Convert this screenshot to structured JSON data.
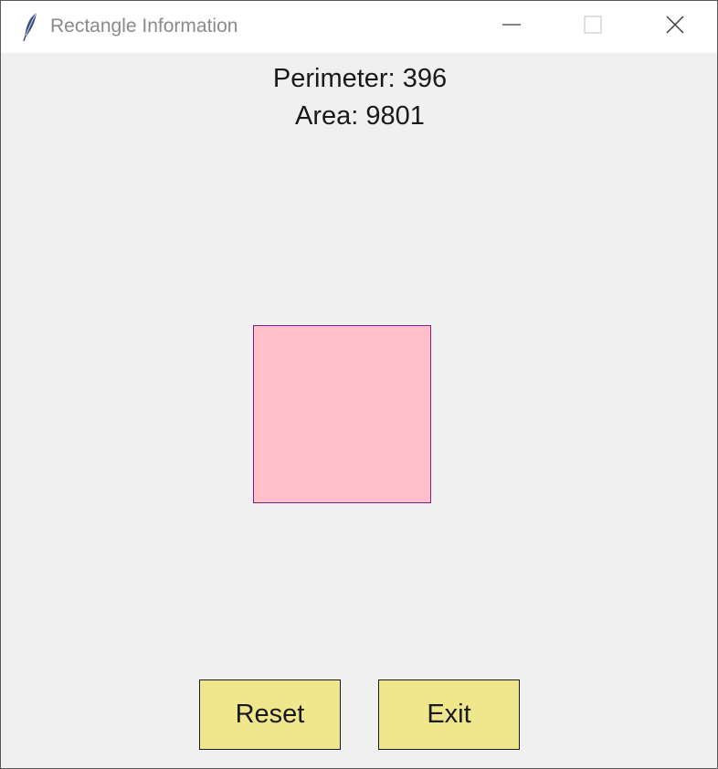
{
  "window": {
    "title": "Rectangle Information",
    "app_icon": "feather-icon",
    "controls": {
      "minimize_icon": "minimize-icon",
      "maximize_icon": "maximize-icon",
      "close_icon": "close-icon"
    }
  },
  "info": {
    "perimeter_text": "Perimeter: 396",
    "area_text": "Area: 9801"
  },
  "shape": {
    "type": "rectangle",
    "fill_color": "#ffc0cb",
    "outline_color": "#8b1a8b"
  },
  "buttons": {
    "reset_label": "Reset",
    "exit_label": "Exit",
    "background_color": "#f0e68c"
  }
}
